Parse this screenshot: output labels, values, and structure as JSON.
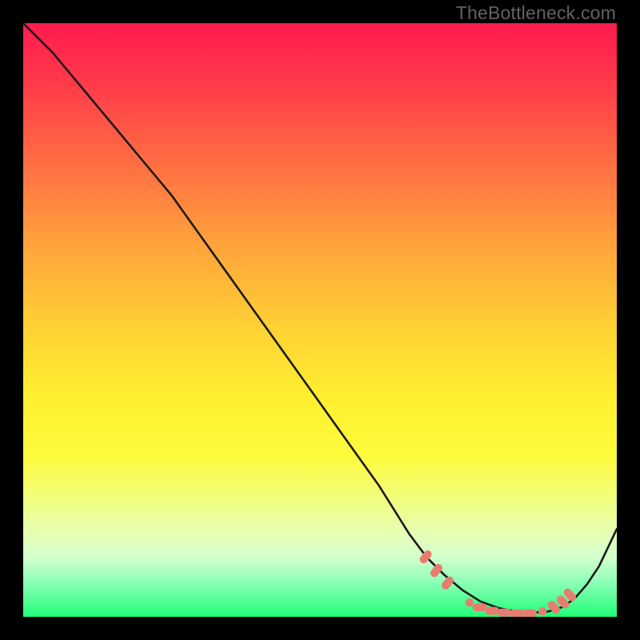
{
  "watermark": "TheBottleneck.com",
  "colors": {
    "curve": "#1b1b1b",
    "dot_fill": "#e77d70",
    "dot_stroke": "#e77d70",
    "background_black": "#000000"
  },
  "chart_data": {
    "type": "line",
    "title": "",
    "xlabel": "",
    "ylabel": "",
    "xlim": [
      0,
      100
    ],
    "ylim": [
      0,
      100
    ],
    "series": [
      {
        "name": "bottleneck-curve",
        "x": [
          0,
          5,
          10,
          15,
          20,
          25,
          30,
          35,
          40,
          45,
          50,
          55,
          60,
          65,
          68,
          71,
          74,
          77,
          80,
          83,
          86,
          88.5,
          91,
          93,
          95,
          97,
          100
        ],
        "y": [
          100,
          95,
          89,
          83,
          77,
          71,
          64,
          57,
          50,
          43,
          36,
          29,
          22,
          14,
          10,
          7,
          4.5,
          2.6,
          1.5,
          0.9,
          0.7,
          0.9,
          1.7,
          3.2,
          5.5,
          8.5,
          14.8
        ]
      }
    ],
    "annotations": {
      "valley_markers": [
        {
          "x": 67.8,
          "y": 10.1,
          "shape": "cap"
        },
        {
          "x": 69.6,
          "y": 7.8,
          "shape": "cap"
        },
        {
          "x": 71.5,
          "y": 5.7,
          "shape": "cap"
        },
        {
          "x": 75.2,
          "y": 2.4,
          "shape": "dot"
        },
        {
          "x": 76.9,
          "y": 1.6,
          "shape": "cap-h"
        },
        {
          "x": 79.0,
          "y": 1.0,
          "shape": "cap-h"
        },
        {
          "x": 81.1,
          "y": 0.7,
          "shape": "cap-h"
        },
        {
          "x": 83.2,
          "y": 0.55,
          "shape": "cap-h"
        },
        {
          "x": 85.3,
          "y": 0.6,
          "shape": "cap-h"
        },
        {
          "x": 87.5,
          "y": 0.9,
          "shape": "dot"
        },
        {
          "x": 89.4,
          "y": 1.6,
          "shape": "cap"
        },
        {
          "x": 90.9,
          "y": 2.5,
          "shape": "cap"
        },
        {
          "x": 92.1,
          "y": 3.7,
          "shape": "cap"
        }
      ]
    }
  }
}
